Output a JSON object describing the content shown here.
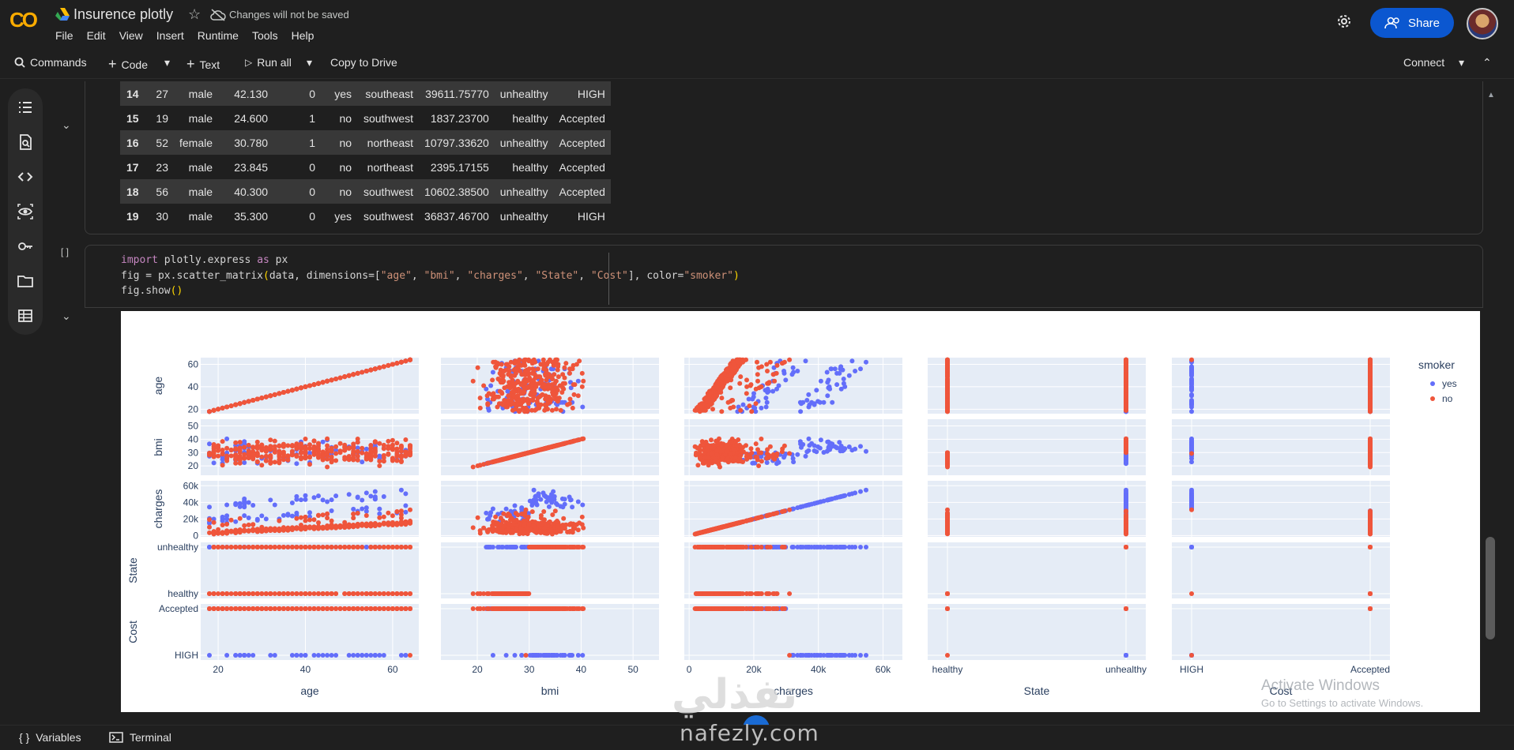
{
  "app": {
    "logo": "CO",
    "title": "Insurence plotly",
    "not_saved": "Changes will not be saved",
    "menu": [
      "File",
      "Edit",
      "View",
      "Insert",
      "Runtime",
      "Tools",
      "Help"
    ],
    "share_label": "Share"
  },
  "toolbar": {
    "commands": "Commands",
    "code": "Code",
    "text": "Text",
    "run_all": "Run all",
    "copy_to_drive": "Copy to Drive",
    "connect": "Connect"
  },
  "dataframe": {
    "rows": [
      [
        "14",
        "27",
        "male",
        "42.130",
        "0",
        "yes",
        "southeast",
        "39611.75770",
        "unhealthy",
        "HIGH"
      ],
      [
        "15",
        "19",
        "male",
        "24.600",
        "1",
        "no",
        "southwest",
        "1837.23700",
        "healthy",
        "Accepted"
      ],
      [
        "16",
        "52",
        "female",
        "30.780",
        "1",
        "no",
        "northeast",
        "10797.33620",
        "unhealthy",
        "Accepted"
      ],
      [
        "17",
        "23",
        "male",
        "23.845",
        "0",
        "no",
        "northeast",
        "2395.17155",
        "healthy",
        "Accepted"
      ],
      [
        "18",
        "56",
        "male",
        "40.300",
        "0",
        "no",
        "southwest",
        "10602.38500",
        "unhealthy",
        "Accepted"
      ],
      [
        "19",
        "30",
        "male",
        "35.300",
        "0",
        "yes",
        "southwest",
        "36837.46700",
        "unhealthy",
        "HIGH"
      ]
    ]
  },
  "code_cell": {
    "run_bracket": "[ ]",
    "line1": "import plotly.express as px",
    "line2": "fig = px.scatter_matrix(data, dimensions=[\"age\", \"bmi\", \"charges\", \"State\", \"Cost\"], color=\"smoker\")",
    "line3": "fig.show()"
  },
  "chart_data": {
    "type": "scatter",
    "subtype": "scatter_matrix",
    "dimensions": [
      "age",
      "bmi",
      "charges",
      "State",
      "Cost"
    ],
    "dimension_ticks": {
      "age": [
        "20",
        "40",
        "60"
      ],
      "bmi": [
        "20",
        "30",
        "40",
        "50"
      ],
      "charges": [
        "0",
        "20k",
        "40k",
        "60k"
      ],
      "State": [
        "healthy",
        "unhealthy"
      ],
      "Cost": [
        "HIGH",
        "Accepted"
      ]
    },
    "ranges": {
      "age": [
        16,
        66
      ],
      "bmi": [
        13,
        55
      ],
      "charges": [
        -1500,
        66000
      ],
      "State": [
        "healthy",
        "unhealthy"
      ],
      "Cost": [
        "HIGH",
        "Accepted"
      ]
    },
    "legend_title": "smoker",
    "series": [
      {
        "name": "yes",
        "color": "#636efa"
      },
      {
        "name": "no",
        "color": "#ef553b"
      }
    ],
    "legend_position": "top-right",
    "grid": true
  },
  "watermarks": {
    "windows_title": "Activate Windows",
    "windows_sub": "Go to Settings to activate Windows.",
    "site": "nafezly.com",
    "site_ar": "نفذلي"
  },
  "bottom": {
    "variables": "Variables",
    "terminal": "Terminal"
  }
}
